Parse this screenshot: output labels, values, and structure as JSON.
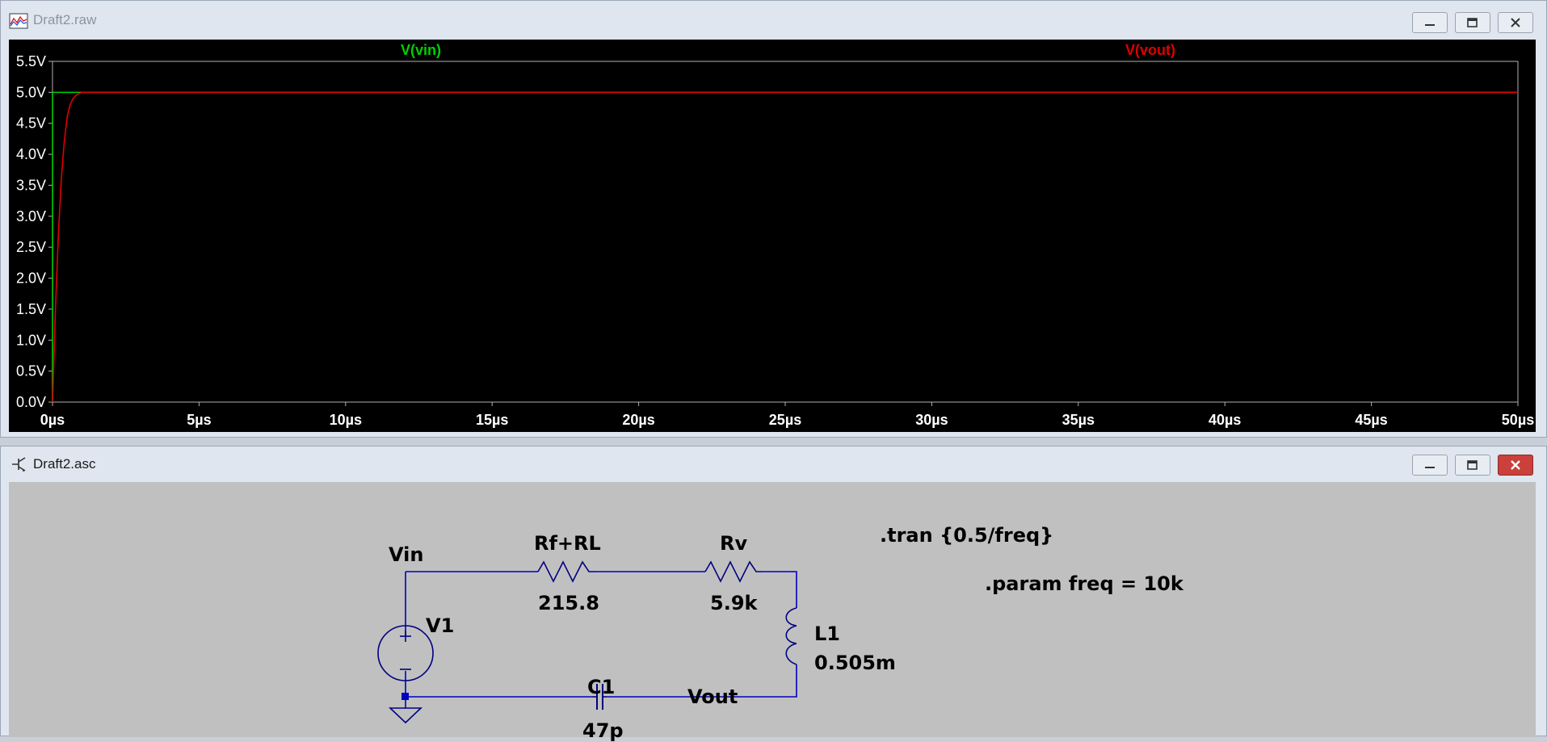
{
  "waveform_window": {
    "title": "Draft2.raw",
    "trace_labels": {
      "vin": "V(vin)",
      "vout": "V(vout)"
    },
    "colors": {
      "vin": "#00d000",
      "vout": "#e00000",
      "axis": "#b0b0b0",
      "text": "#ffffff"
    }
  },
  "chart_data": {
    "type": "line",
    "xlabel": "",
    "ylabel": "",
    "x_unit": "µs",
    "y_unit": "V",
    "xlim": [
      0,
      50
    ],
    "ylim": [
      0,
      5.5
    ],
    "x_ticks": [
      "0µs",
      "5µs",
      "10µs",
      "15µs",
      "20µs",
      "25µs",
      "30µs",
      "35µs",
      "40µs",
      "45µs",
      "50µs"
    ],
    "y_ticks": [
      "0.0V",
      "0.5V",
      "1.0V",
      "1.5V",
      "2.0V",
      "2.5V",
      "3.0V",
      "3.5V",
      "4.0V",
      "4.5V",
      "5.0V",
      "5.5V"
    ],
    "series": [
      {
        "name": "V(vin)",
        "color": "#00d000",
        "x": [
          0,
          0.001,
          50
        ],
        "y": [
          0,
          5,
          5
        ]
      },
      {
        "name": "V(vout)",
        "color": "#e00000",
        "x": [
          0,
          0.1,
          0.2,
          0.3,
          0.4,
          0.5,
          0.6,
          0.7,
          0.8,
          0.9,
          1.0,
          1.1,
          50
        ],
        "y": [
          0,
          1.5,
          2.7,
          3.6,
          4.2,
          4.6,
          4.8,
          4.9,
          4.95,
          4.98,
          5.0,
          5.0,
          5.0
        ]
      }
    ],
    "grid": false,
    "legend": "top"
  },
  "schematic_window": {
    "title": "Draft2.asc",
    "directives": {
      "tran": ".tran {0.5/freq}",
      "param": ".param freq = 10k"
    },
    "nets": {
      "vin": "Vin",
      "vout": "Vout"
    },
    "components": {
      "v1": {
        "name": "V1"
      },
      "r1": {
        "name": "Rf+RL",
        "value": "215.8"
      },
      "r2": {
        "name": "Rv",
        "value": "5.9k"
      },
      "l1": {
        "name": "L1",
        "value": "0.505m"
      },
      "c1": {
        "name": "C1",
        "value": "47p"
      }
    },
    "colors": {
      "wire": "#0000c0",
      "background": "#c0c0c0",
      "text": "#000000"
    }
  }
}
